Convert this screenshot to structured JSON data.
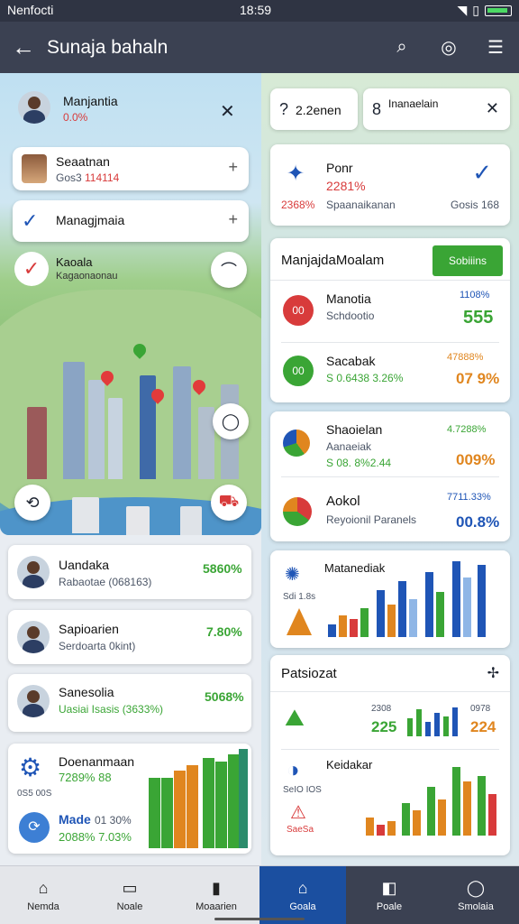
{
  "status": {
    "carrier": "Nenfocti",
    "time": "18:59"
  },
  "appbar": {
    "title": "Sunaja bahaln"
  },
  "map": {
    "user": {
      "name": "Manjantia",
      "value": "0.0%"
    },
    "list": [
      {
        "title": "Seaatnan",
        "sub": "Gos3 ",
        "sub2": "114114"
      },
      {
        "title": "Managjmaia"
      },
      {
        "title": "Kaoala",
        "sub": "Kagaonaonau"
      }
    ]
  },
  "right": {
    "search1": "2.2enen",
    "search2": "Inanaelain",
    "stat": {
      "title": "Ponr",
      "value": "2281%",
      "left": "2368%",
      "mid": "Spaanaikanan",
      "right": "Gosis 168"
    },
    "panel": {
      "title": "ManjajdaMoalam",
      "button": "Sobiiins",
      "rows": [
        {
          "badge": "00",
          "title": "Manotia",
          "sub": "Schdootio",
          "small": "1108%",
          "value": "555",
          "color": "#d83b3b"
        },
        {
          "badge": "00",
          "title": "Sacabak",
          "sub": "S 0.6438 ",
          "sub2": "3.26%",
          "small": "47888%",
          "value": "07 9%",
          "color": "#3aa535"
        }
      ]
    },
    "panel2": {
      "rows": [
        {
          "title": "Shaoielan",
          "sub": "Aanaeiak",
          "sub2": "S 08. 8%2.44",
          "small": "4.7288%",
          "value": "009%"
        },
        {
          "title": "Aokol",
          "sub": "Reyoionil Paranels",
          "small": "7711.33%",
          "value": "00.8%"
        }
      ]
    },
    "chart1": {
      "title": "Matanediak",
      "tick": "Sdi 1.8s"
    },
    "panel3": {
      "title": "Patsiozat",
      "v1": "225",
      "v2": "224",
      "t1": "2308",
      "t2": "0978",
      "sub": "Keidakar",
      "tick": "SeIO IOS",
      "tick2": "SaeSa"
    }
  },
  "people": [
    {
      "name": "Uandaka",
      "sub": "Rabaotae (068163)",
      "value": "5860%"
    },
    {
      "name": "Sapioarien",
      "sub": "Serdoarta 0kint)",
      "value": "7.80%"
    },
    {
      "name": "Sanesolia",
      "sub": "Uasiai Isasis (3633%)",
      "value": "5068%"
    }
  ],
  "summary": {
    "title": "Doenanmaan",
    "value": "7289%",
    "value2": "88",
    "label": "Made",
    "label2": "01 30%",
    "value3": "2088%",
    "value4": "7.03%",
    "tick": "0S5 00S"
  },
  "nav": [
    {
      "label": "Nemda",
      "icon": "home-icon",
      "glyph": "⌂"
    },
    {
      "label": "Noale",
      "icon": "board-icon",
      "glyph": "▭"
    },
    {
      "label": "Moaarien",
      "icon": "document-icon",
      "glyph": "▮"
    },
    {
      "label": "Goala",
      "icon": "home-icon",
      "glyph": "⌂"
    },
    {
      "label": "Poale",
      "icon": "window-icon",
      "glyph": "◧"
    },
    {
      "label": "Smolaia",
      "icon": "profile-icon",
      "glyph": "◯"
    }
  ]
}
